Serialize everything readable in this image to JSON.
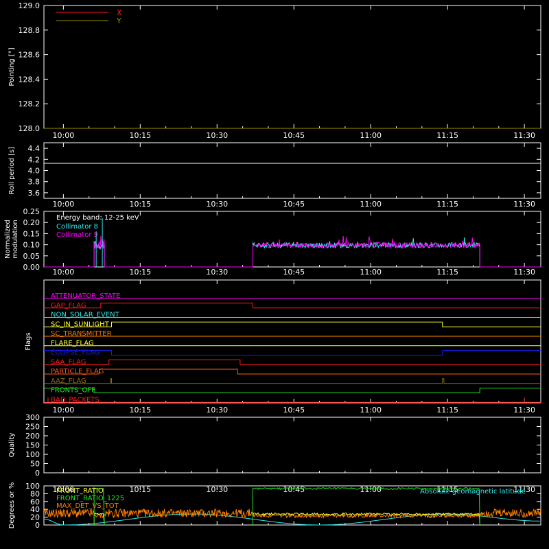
{
  "time_axis": {
    "tick_labels": [
      "10:00",
      "10:15",
      "10:30",
      "10:45",
      "11:00",
      "11:15",
      "11:30"
    ],
    "tick_minutes": [
      0,
      15,
      30,
      45,
      60,
      75,
      90
    ],
    "range_minutes": [
      -3.8,
      93.2
    ]
  },
  "colors": {
    "axis": "#ffffff",
    "background": "#000000",
    "red": "#ff1a1a",
    "olive": "#9a8c00",
    "white": "#ffffff",
    "cyan": "#33e8e8",
    "magenta": "#ff00ff",
    "green": "#22e622",
    "orange": "#ff7f00",
    "yellow": "#ffff33",
    "blue": "#1a1aff",
    "dark_orange": "#ff5a1f",
    "brown": "#8b6b1a"
  },
  "chart_data": [
    {
      "id": "pointing",
      "type": "line",
      "ylabel": "Pointing [°]",
      "ylim": [
        128.0,
        129.0
      ],
      "yticks": [
        "128.0",
        "128.2",
        "128.4",
        "128.6",
        "128.8",
        "129.0"
      ],
      "ytick_values": [
        128.0,
        128.2,
        128.4,
        128.6,
        128.8,
        129.0
      ],
      "legend": [
        {
          "name": "X",
          "color": "#ff1a1a"
        },
        {
          "name": "Y",
          "color": "#9a8c00"
        }
      ],
      "series": [
        {
          "name": "X",
          "color": "#ff1a1a",
          "x": [],
          "y": []
        },
        {
          "name": "Y",
          "color": "#9a8c00",
          "x": [
            -3.8,
            93.2
          ],
          "y": [
            128.0,
            128.0
          ]
        }
      ]
    },
    {
      "id": "roll",
      "type": "line",
      "ylabel": "Roll period [s]",
      "ylim": [
        3.5,
        4.5
      ],
      "yticks": [
        "3.6",
        "3.8",
        "4.0",
        "4.2",
        "4.4"
      ],
      "ytick_values": [
        3.6,
        3.8,
        4.0,
        4.2,
        4.4
      ],
      "series": [
        {
          "name": "",
          "color": "#ffffff",
          "x": [
            -3.8,
            93.2
          ],
          "y": [
            4.13,
            4.13
          ]
        }
      ]
    },
    {
      "id": "modulation",
      "type": "line",
      "ylabel": "Normalized modulation",
      "ylim": [
        0.0,
        0.25
      ],
      "yticks": [
        "0.00",
        "0.05",
        "0.10",
        "0.15",
        "0.20",
        "0.25"
      ],
      "ytick_values": [
        0.0,
        0.05,
        0.1,
        0.15,
        0.2,
        0.25
      ],
      "annotation": "Energy band: 12-25 keV",
      "legend": [
        {
          "name": "Collimator 8",
          "color": "#33e8e8"
        },
        {
          "name": "Collimator 9",
          "color": "#ff00ff"
        }
      ],
      "baseline": 0.0,
      "segments": [
        {
          "start": 6.0,
          "end": 8.0,
          "level": 0.1,
          "spread": 0.02,
          "spike": 0.16
        },
        {
          "start": 37.0,
          "end": 81.3,
          "level": 0.098,
          "spread": 0.012,
          "spike": 0.14
        }
      ],
      "series": [
        {
          "name": "Collimator 8",
          "color": "#33e8e8"
        },
        {
          "name": "Collimator 9",
          "color": "#ff00ff"
        }
      ]
    },
    {
      "id": "flags",
      "type": "line",
      "ylabel": "Flags",
      "flags": [
        {
          "name": "ATTENUATOR_STATE",
          "color": "#ff00ff",
          "transitions": [],
          "initial": 0
        },
        {
          "name": "GAP_FLAG",
          "color": "#ff1a1a",
          "transitions": [
            7.3,
            37.0
          ],
          "initial": 0
        },
        {
          "name": "NON_SOLAR_EVENT",
          "color": "#33e8e8",
          "transitions": [],
          "initial": 0
        },
        {
          "name": "SC_IN_SUNLIGHT",
          "color": "#ffff33",
          "transitions": [
            9.4,
            74.0
          ],
          "initial": 0
        },
        {
          "name": "SC_TRANSMITTER",
          "color": "#ff7f00",
          "transitions": [],
          "initial": 0
        },
        {
          "name": "FLARE_FLAG",
          "color": "#ffff33",
          "transitions": [],
          "initial": 0
        },
        {
          "name": "ECLIPSE_FLAG",
          "color": "#1a1aff",
          "transitions": [
            9.4,
            74.0
          ],
          "initial": 1
        },
        {
          "name": "SAA_FLAG",
          "color": "#ff1a1a",
          "transitions": [
            8.9,
            34.5
          ],
          "initial": 0
        },
        {
          "name": "PARTICLE_FLAG",
          "color": "#ff5a1f",
          "transitions": [
            7.0,
            34.0
          ],
          "initial": 0
        },
        {
          "name": "AAZ_FLAG",
          "color": "#8b6b1a",
          "transitions": [
            9.2,
            9.4,
            74.0,
            74.3
          ],
          "initial": 0
        },
        {
          "name": "FRONTS_OFF",
          "color": "#22e622",
          "transitions": [
            6.0,
            81.3
          ],
          "initial": 1
        },
        {
          "name": "BAD_PACKETS",
          "color": "#ff1a1a",
          "transitions": [],
          "initial": 0,
          "ticks": [
            -3.0,
            90.0
          ]
        }
      ]
    },
    {
      "id": "quality",
      "type": "line",
      "ylabel": "Quality",
      "ylim": [
        0,
        300
      ],
      "yticks": [
        "0",
        "50",
        "100",
        "150",
        "200",
        "250",
        "300"
      ],
      "ytick_values": [
        0,
        50,
        100,
        150,
        200,
        250,
        300
      ],
      "series": []
    },
    {
      "id": "ratios",
      "type": "line",
      "ylabel": "Degrees or %",
      "ylim": [
        0,
        100
      ],
      "yticks": [
        "0",
        "20",
        "40",
        "60",
        "80",
        "100"
      ],
      "ytick_values": [
        0,
        20,
        40,
        60,
        80,
        100
      ],
      "legend": [
        {
          "name": "FRONT_RATIO",
          "color": "#ffff33"
        },
        {
          "name": "FRONT_RATIO_1225",
          "color": "#22e622"
        },
        {
          "name": "MAX_DET_VS_TOT",
          "color": "#ff7f00"
        }
      ],
      "right_label": {
        "name": "Absolute geomagnetic latitude",
        "color": "#33e8e8"
      },
      "geomagnetic_latitude": {
        "color": "#33e8e8",
        "x": [
          -3.8,
          0.0,
          25.0,
          50.0,
          75.0,
          93.2
        ],
        "y": [
          15,
          0,
          28,
          0,
          28,
          10
        ]
      },
      "sunlit_windows": [
        [
          6.0,
          8.0
        ],
        [
          37.0,
          81.3
        ]
      ],
      "front_ratio_1225_level": 93,
      "front_ratio_level": 28,
      "max_det_vs_tot_level": 24,
      "night_max_det_level": 30
    }
  ]
}
